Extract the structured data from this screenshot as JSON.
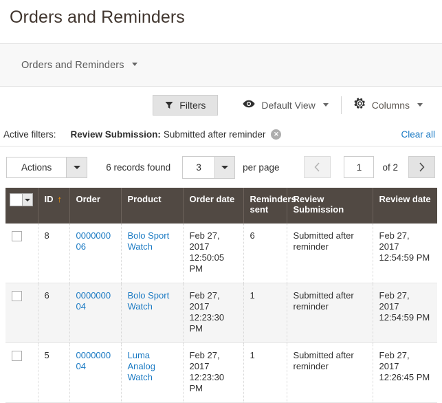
{
  "page": {
    "title": "Orders and Reminders"
  },
  "page_bar": {
    "label": "Orders and Reminders",
    "caret_icon": "chevron-down-icon"
  },
  "toolbar": {
    "filters_label": "Filters",
    "filters_icon": "funnel-icon",
    "view_icon": "eye-icon",
    "view_label": "Default View",
    "columns_icon": "gear-icon",
    "columns_label": "Columns",
    "caret_icon": "chevron-down-icon"
  },
  "active_filters": {
    "label": "Active filters:",
    "chip_label": "Review Submission:",
    "chip_value": "Submitted after reminder",
    "chip_remove_icon": "close-circle-icon",
    "clear_all": "Clear all"
  },
  "controls": {
    "actions_label": "Actions",
    "actions_caret_icon": "chevron-down-icon",
    "records_found": "6 records found",
    "per_page_value": "3",
    "per_page_caret_icon": "chevron-down-icon",
    "per_page_label": "per page",
    "prev_icon": "chevron-left-icon",
    "next_icon": "chevron-right-icon",
    "current_page": "1",
    "of_label": "of 2"
  },
  "table": {
    "select_all_icon": "checkbox-dropdown-icon",
    "sort_arrow": "↑",
    "columns": [
      {
        "key": "checkbox",
        "label": ""
      },
      {
        "key": "id",
        "label": "ID",
        "sorted": "asc"
      },
      {
        "key": "order",
        "label": "Order"
      },
      {
        "key": "product",
        "label": "Product"
      },
      {
        "key": "order_date",
        "label": "Order date"
      },
      {
        "key": "reminders_sent",
        "label": "Reminders sent"
      },
      {
        "key": "review_submission",
        "label": "Review Submission"
      },
      {
        "key": "review_date",
        "label": "Review date"
      }
    ],
    "rows": [
      {
        "id": "8",
        "order": "000000006",
        "product": "Bolo Sport Watch",
        "order_date": "Feb 27, 2017 12:50:05 PM",
        "reminders_sent": "6",
        "review_submission": "Submitted after reminder",
        "review_date": "Feb 27, 2017 12:54:59 PM"
      },
      {
        "id": "6",
        "order": "000000004",
        "product": "Bolo Sport Watch",
        "order_date": "Feb 27, 2017 12:23:30 PM",
        "reminders_sent": "1",
        "review_submission": "Submitted after reminder",
        "review_date": "Feb 27, 2017 12:54:59 PM"
      },
      {
        "id": "5",
        "order": "000000004",
        "product": "Luma Analog Watch",
        "order_date": "Feb 27, 2017 12:23:30 PM",
        "reminders_sent": "1",
        "review_submission": "Submitted after reminder",
        "review_date": "Feb 27, 2017 12:26:45 PM"
      }
    ]
  },
  "colors": {
    "header_bg": "#514943",
    "link": "#1979c3",
    "sort_arrow": "#ff9700",
    "title": "#41362f"
  }
}
